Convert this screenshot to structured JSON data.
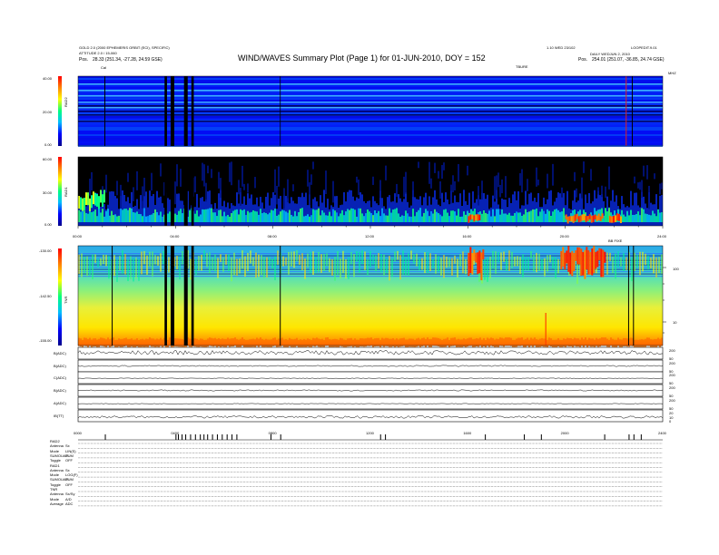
{
  "header": {
    "title": "WIND/WAVES Summary Plot (Page 1) for 01-JUN-2010, DOY = 152",
    "left_line1": "GOLD 2.0 (2000 EPHEMERIS ORBIT (ECI), SPECIFIC)",
    "left_line2": "ATTITUDE 2.0 / 15-060",
    "left_pos_label": "Pos.",
    "left_pos_value": "28.33 (251.34, -27.28, 24.59 GSE)",
    "right_line1": "1.10 WED 23/102",
    "right_line2": "LOOPEDIT.9.01",
    "right_line3": "DAILY WEDJUN 2, 2010",
    "right_pos_label": "Pos.",
    "right_pos_value": "254.01 (251.07, -36.85, 24.74 GSE)",
    "cal_label": "Cal",
    "top_marker": "TBURE",
    "top_right_marker": "MHZ"
  },
  "panels": {
    "rad2": {
      "label": "RAD2",
      "ticks": [
        "40.00",
        "20.00",
        "0.00"
      ]
    },
    "rad1": {
      "label": "RAD1",
      "ticks": [
        "60.00",
        "30.00",
        "0.00"
      ]
    },
    "tnr": {
      "label": "TNR",
      "ticks": [
        "-130.00",
        "-142.50",
        "-155.00"
      ],
      "right_ticks": [
        "100",
        "10"
      ],
      "marker": "BB FIXE"
    }
  },
  "time_axis_1": [
    "00:00",
    "04:00",
    "08:00",
    "12:00",
    "16:00",
    "20:00",
    "24:00"
  ],
  "time_axis_2": [
    "0000",
    "0400",
    "0800",
    "1200",
    "1600",
    "2000",
    "2400"
  ],
  "traces": [
    {
      "label": "B(ADC)",
      "right_ticks": [
        "200",
        "50"
      ]
    },
    {
      "label": "B(ADC)",
      "right_ticks": [
        "200",
        "50"
      ]
    },
    {
      "label": "C(ADC)",
      "right_ticks": [
        "200",
        "50"
      ]
    },
    {
      "label": "B(ADC)",
      "right_ticks": [
        "200",
        "50"
      ]
    },
    {
      "label": "A(ADC)",
      "right_ticks": [
        "200",
        "50"
      ]
    },
    {
      "label": "IB(TT)",
      "right_ticks": [
        "20",
        "10",
        "0"
      ]
    }
  ],
  "info_block": [
    {
      "k": "RAD2",
      "v": ""
    },
    {
      "k": "Antenna",
      "v": "Sx"
    },
    {
      "k": "Mode",
      "v": "LIN(S)"
    },
    {
      "k": "SUMOUAP",
      "v": "SUM"
    },
    {
      "k": "Toggle",
      "v": "OFF"
    },
    {
      "k": "RAD1",
      "v": ""
    },
    {
      "k": "Antenna",
      "v": "Sx"
    },
    {
      "k": "Mode",
      "v": "LOG(F)"
    },
    {
      "k": "SUMOUAP",
      "v": "SUM"
    },
    {
      "k": "Toggle",
      "v": "OFF"
    },
    {
      "k": "TNR",
      "v": ""
    },
    {
      "k": "Antenna",
      "v": "Sx/Sy"
    },
    {
      "k": "Mode",
      "v": "A/D"
    },
    {
      "k": "Average",
      "v": "ADC"
    }
  ],
  "chart_data": [
    {
      "type": "heatmap",
      "title": "WIND/WAVES Summary Plot (Page 1) for 01-JUN-2010, DOY = 152",
      "ylabel": "RAD2",
      "ylim": [
        0,
        40
      ],
      "x_range_hours": [
        0,
        24
      ],
      "colorscale": [
        "#00008b",
        "#0000ff",
        "#00bfff",
        "#00ff80",
        "#ffff00",
        "#ff8000",
        "#ff0000"
      ],
      "data_gaps_hours": [
        [
          3.55,
          3.65
        ],
        [
          3.8,
          3.95
        ],
        [
          4.35,
          4.5
        ],
        [
          4.65,
          4.75
        ]
      ],
      "cal_hours": 1.1
    },
    {
      "type": "heatmap",
      "ylabel": "RAD1",
      "ylim": [
        0,
        60
      ],
      "x_range_hours": [
        0,
        24
      ],
      "intense_emission_hours": [
        [
          16.0,
          16.5
        ],
        [
          20.0,
          21.5
        ],
        [
          21.8,
          22.3
        ]
      ]
    },
    {
      "type": "heatmap",
      "ylabel": "TNR",
      "ylim": [
        -155,
        -130
      ],
      "x_range_hours": [
        0,
        24
      ],
      "intense_emission_hours": [
        [
          16.0,
          16.6
        ],
        [
          19.8,
          21.6
        ]
      ]
    },
    {
      "type": "line",
      "series": [
        {
          "name": "B(ADC)",
          "level": 0.55,
          "noise": 0.18
        },
        {
          "name": "B(ADC)",
          "level": 0.5,
          "noise": 0.05
        },
        {
          "name": "C(ADC)",
          "level": 0.45,
          "noise": 0.02
        },
        {
          "name": "B(ADC)",
          "level": 0.5,
          "noise": 0.05
        },
        {
          "name": "A(ADC)",
          "level": 0.45,
          "noise": 0.02
        },
        {
          "name": "IB(TT)",
          "level": 0.4,
          "noise": 0.1
        }
      ],
      "x_range_hours": [
        0,
        24
      ]
    }
  ]
}
